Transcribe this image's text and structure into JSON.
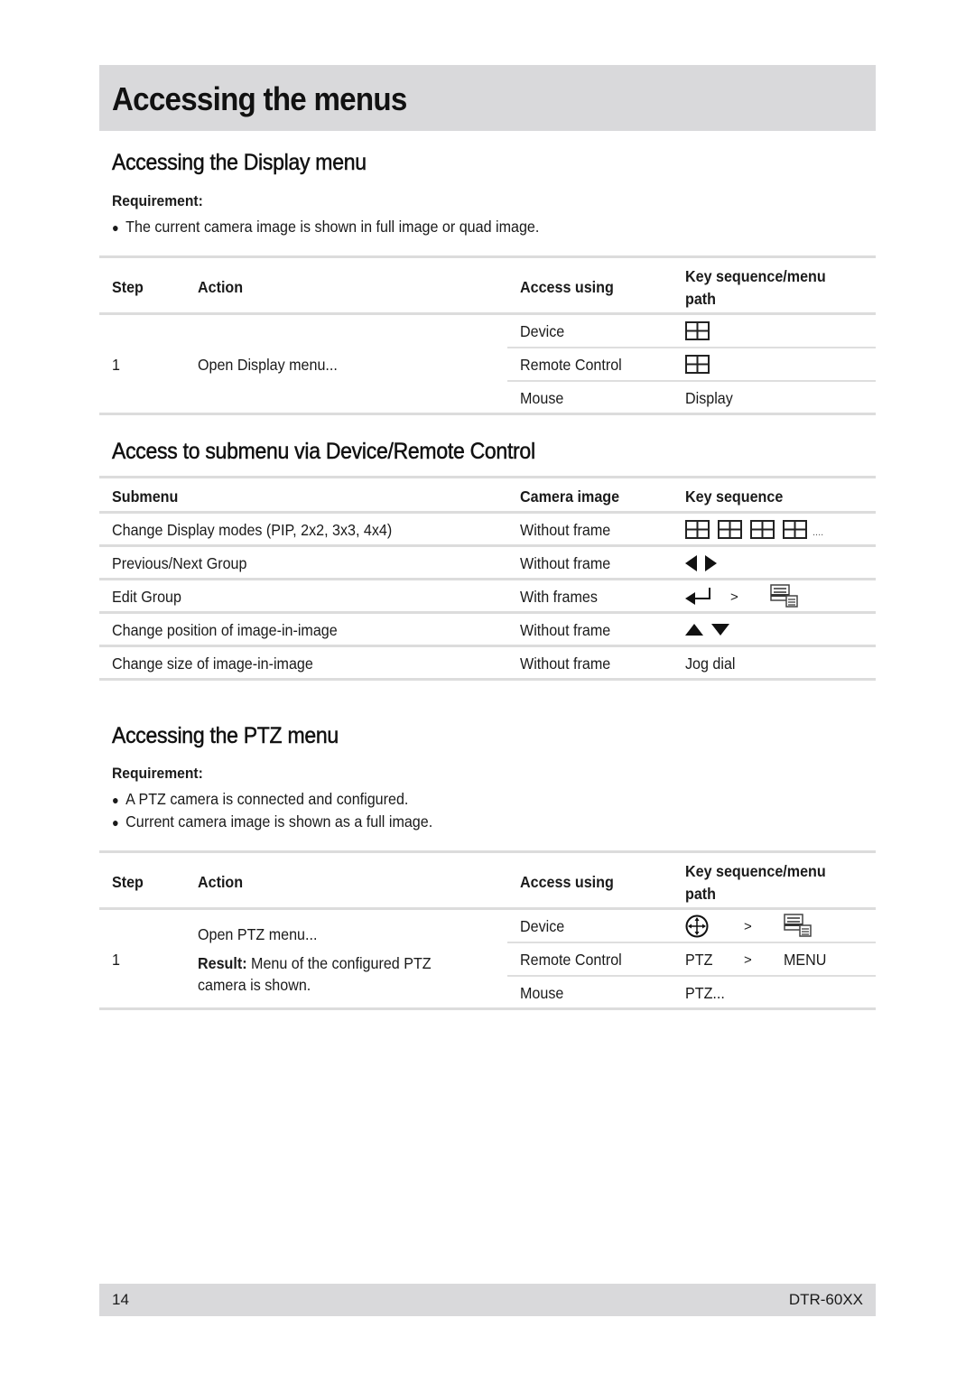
{
  "page": {
    "title": "Accessing the menus",
    "page_number": "14",
    "model": "DTR-60XX"
  },
  "display_section": {
    "heading": "Accessing the Display menu",
    "requirement_label": "Requirement:",
    "requirements": [
      "The current camera image is shown in full image or quad image."
    ],
    "table": {
      "headers": {
        "step": "Step",
        "action": "Action",
        "access": "Access using",
        "key_line1": "Key sequence/menu",
        "key_line2": "path"
      },
      "step": "1",
      "action": "Open Display menu...",
      "rows": [
        {
          "access": "Device",
          "key_icon": "quad-view-icon",
          "key_text": ""
        },
        {
          "access": "Remote Control",
          "key_icon": "quad-view-icon",
          "key_text": ""
        },
        {
          "access": "Mouse",
          "key_icon": "",
          "key_text": "Display"
        }
      ]
    }
  },
  "submenu_section": {
    "heading": "Access to submenu via Device/Remote Control",
    "table": {
      "headers": {
        "submenu": "Submenu",
        "camera": "Camera image",
        "key": "Key sequence"
      },
      "rows": [
        {
          "submenu": "Change Display modes (PIP, 2x2, 3x3, 4x4)",
          "camera": "Without frame",
          "key_icons": [
            "quad-view-icon",
            "quad-view-icon",
            "quad-view-icon",
            "quad-view-icon"
          ],
          "key_suffix": "...."
        },
        {
          "submenu": "Previous/Next Group",
          "camera": "Without frame",
          "key_icons": [
            "arrow-left-icon",
            "arrow-right-icon"
          ]
        },
        {
          "submenu": "Edit Group",
          "camera": "With frames",
          "key_icons": [
            "enter-icon",
            "menu-icon"
          ],
          "separator": ">"
        },
        {
          "submenu": "Change position of image-in-image",
          "camera": "Without frame",
          "key_icons": [
            "arrow-up-icon",
            "arrow-down-icon"
          ]
        },
        {
          "submenu": "Change size of image-in-image",
          "camera": "Without frame",
          "key_text": "Jog dial"
        }
      ]
    }
  },
  "ptz_section": {
    "heading": "Accessing the PTZ menu",
    "requirement_label": "Requirement:",
    "requirements": [
      "A PTZ camera is connected and configured.",
      "Current camera image is shown as a full image."
    ],
    "table": {
      "headers": {
        "step": "Step",
        "action": "Action",
        "access": "Access using",
        "key_line1": "Key sequence/menu",
        "key_line2": "path"
      },
      "step": "1",
      "action": "Open PTZ menu...",
      "result_label": "Result:",
      "result_text_line1": "Menu of the configured PTZ",
      "result_text_line2": "camera is shown.",
      "rows": [
        {
          "access": "Device",
          "key_icons": [
            "ptz-joystick-icon",
            "menu-icon"
          ],
          "separator": ">"
        },
        {
          "access": "Remote Control",
          "key_text": "PTZ",
          "separator": ">",
          "key_text2": "MENU"
        },
        {
          "access": "Mouse",
          "key_text": "PTZ..."
        }
      ]
    }
  }
}
